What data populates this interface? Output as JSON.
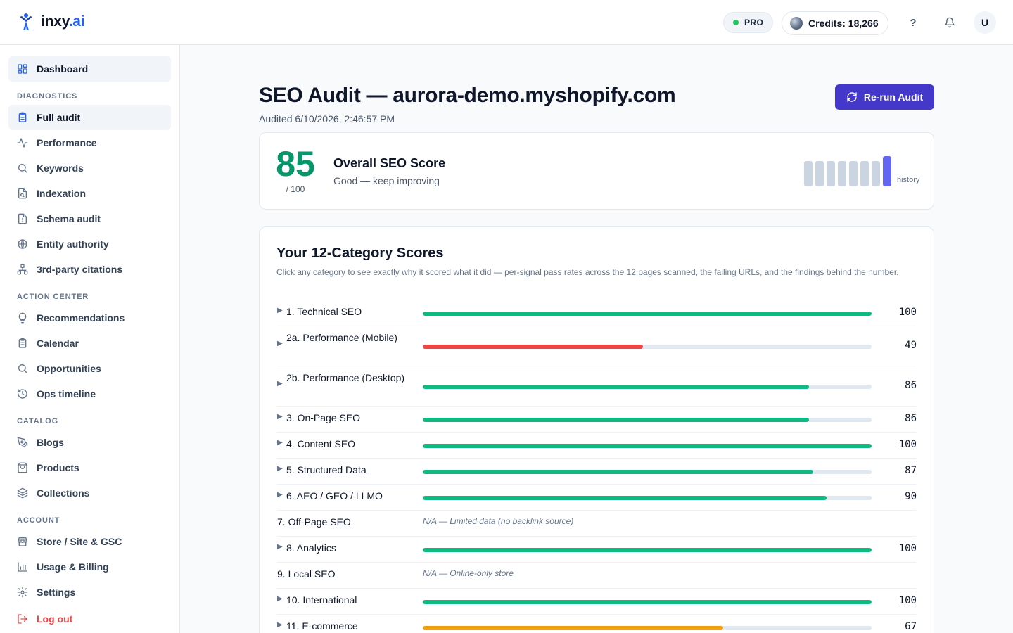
{
  "brand": {
    "name_main": "inxy",
    "name_accent": ".ai"
  },
  "header": {
    "plan_badge": "PRO",
    "credits_label": "Credits: 18,266",
    "help_label": "?",
    "avatar_initial": "U"
  },
  "colors": {
    "primary": "#4338ca",
    "good": "#10b981",
    "warn": "#f59e0b",
    "bad": "#ef4444",
    "score": "#059669"
  },
  "sidebar": {
    "dashboard": {
      "label": "Dashboard",
      "icon": "grid-icon"
    },
    "sections": [
      {
        "title": "DIAGNOSTICS",
        "items": [
          {
            "label": "Full audit",
            "icon": "clipboard-icon",
            "active": true
          },
          {
            "label": "Performance",
            "icon": "activity-icon"
          },
          {
            "label": "Keywords",
            "icon": "search-icon"
          },
          {
            "label": "Indexation",
            "icon": "file-search-icon"
          },
          {
            "label": "Schema audit",
            "icon": "file-alert-icon"
          },
          {
            "label": "Entity authority",
            "icon": "globe-icon"
          },
          {
            "label": "3rd-party citations",
            "icon": "network-icon"
          }
        ]
      },
      {
        "title": "ACTION CENTER",
        "items": [
          {
            "label": "Recommendations",
            "icon": "lightbulb-icon"
          },
          {
            "label": "Calendar",
            "icon": "clipboard-list-icon"
          },
          {
            "label": "Opportunities",
            "icon": "search-icon"
          },
          {
            "label": "Ops timeline",
            "icon": "history-icon"
          }
        ]
      },
      {
        "title": "CATALOG",
        "items": [
          {
            "label": "Blogs",
            "icon": "pen-icon"
          },
          {
            "label": "Products",
            "icon": "shopping-bag-icon"
          },
          {
            "label": "Collections",
            "icon": "layers-icon"
          }
        ]
      },
      {
        "title": "ACCOUNT",
        "items": [
          {
            "label": "Store / Site & GSC",
            "icon": "store-icon"
          },
          {
            "label": "Usage & Billing",
            "icon": "bar-chart-icon"
          },
          {
            "label": "Settings",
            "icon": "gear-icon"
          }
        ]
      }
    ],
    "logout": {
      "label": "Log out",
      "icon": "logout-icon"
    }
  },
  "main": {
    "title": "SEO Audit — aurora-demo.myshopify.com",
    "audited": "Audited 6/10/2026, 2:46:57 PM",
    "rerun_label": "Re-run Audit",
    "overall": {
      "score": "85",
      "max": "/ 100",
      "title": "Overall SEO Score",
      "description": "Good — keep improving",
      "history_label": "history",
      "history": [
        0.82,
        0.82,
        0.84,
        0.86,
        0.85,
        0.87,
        0.86,
        0.85
      ]
    },
    "categories": {
      "title": "Your 12-Category Scores",
      "description": "Click any category to see exactly why it scored what it did — per-signal pass rates across the 12 pages scanned, the failing URLs, and the findings behind the number.",
      "rows": [
        {
          "name": "1. Technical SEO",
          "score": 100,
          "display": "100",
          "status": "good",
          "expandable": true
        },
        {
          "name": "2a. Performance (Mobile)",
          "score": 49,
          "display": "49",
          "status": "bad",
          "expandable": true
        },
        {
          "name": "2b. Performance (Desktop)",
          "score": 86,
          "display": "86",
          "status": "good",
          "expandable": true
        },
        {
          "name": "3. On-Page SEO",
          "score": 86,
          "display": "86",
          "status": "good",
          "expandable": true
        },
        {
          "name": "4. Content SEO",
          "score": 100,
          "display": "100",
          "status": "good",
          "expandable": true
        },
        {
          "name": "5. Structured Data",
          "score": 87,
          "display": "87",
          "status": "good",
          "expandable": true
        },
        {
          "name": "6. AEO / GEO / LLMO",
          "score": 90,
          "display": "90",
          "status": "good",
          "expandable": true
        },
        {
          "name": "7. Off-Page SEO",
          "na": "N/A — Limited data (no backlink source)",
          "expandable": false
        },
        {
          "name": "8. Analytics",
          "score": 100,
          "display": "100",
          "status": "good",
          "expandable": true
        },
        {
          "name": "9. Local SEO",
          "na": "N/A — Online-only store",
          "expandable": false
        },
        {
          "name": "10. International",
          "score": 100,
          "display": "100",
          "status": "good",
          "expandable": true
        },
        {
          "name": "11. E-commerce",
          "score": 67,
          "display": "67",
          "status": "warn",
          "expandable": true
        }
      ]
    }
  }
}
